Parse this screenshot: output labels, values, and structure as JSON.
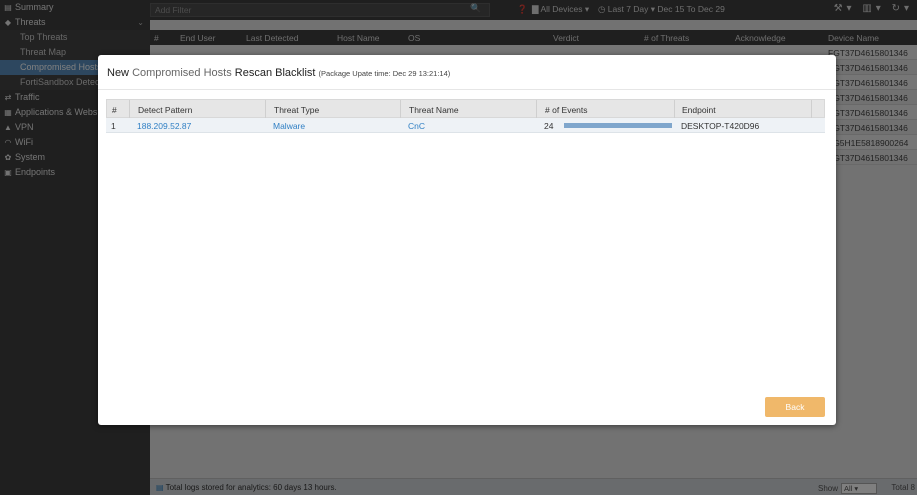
{
  "sidebar": {
    "items": [
      {
        "label": "Summary",
        "icon": "▤",
        "name": "sidebar-item-summary",
        "icon_name": "summary-icon",
        "sub": false
      },
      {
        "label": "Threats",
        "icon": "◆",
        "name": "sidebar-item-threats",
        "icon_name": "threats-icon",
        "sub": false,
        "expanded": true
      },
      {
        "label": "Top Threats",
        "name": "sidebar-item-top-threats",
        "sub": true
      },
      {
        "label": "Threat Map",
        "name": "sidebar-item-threat-map",
        "sub": true
      },
      {
        "label": "Compromised Hosts",
        "name": "sidebar-item-compromised-hosts",
        "sub": true,
        "active": true
      },
      {
        "label": "FortiSandbox Detecti",
        "name": "sidebar-item-fortisandbox",
        "sub": true
      },
      {
        "label": "Traffic",
        "icon": "⇄",
        "name": "sidebar-item-traffic",
        "icon_name": "traffic-icon",
        "sub": false
      },
      {
        "label": "Applications & Webs",
        "icon": "▦",
        "name": "sidebar-item-applications",
        "icon_name": "applications-icon",
        "sub": false
      },
      {
        "label": "VPN",
        "icon": "▲",
        "name": "sidebar-item-vpn",
        "icon_name": "lock-icon",
        "sub": false
      },
      {
        "label": "WiFi",
        "icon": "◠",
        "name": "sidebar-item-wifi",
        "icon_name": "wifi-icon",
        "sub": false
      },
      {
        "label": "System",
        "icon": "✿",
        "name": "sidebar-item-system",
        "icon_name": "gear-icon",
        "sub": false
      },
      {
        "label": "Endpoints",
        "icon": "▣",
        "name": "sidebar-item-endpoints",
        "icon_name": "endpoints-icon",
        "sub": false
      }
    ]
  },
  "toolbar": {
    "filter_placeholder": "Add Filter",
    "help": "❓",
    "devices": "All Devices ▾",
    "timerange": "Last 7 Day ▾  Dec 15 To Dec 29",
    "tools": "⚒▾ ▥▾ ↻▾"
  },
  "grid": {
    "columns": [
      "#",
      "End User",
      "Last Detected",
      "Host Name",
      "OS",
      "Verdict",
      "# of Threats",
      "Acknowledge",
      "Device Name"
    ],
    "device_names": [
      "FGT37D4615801346",
      "FGT37D4615801346",
      "FGT37D4615801346",
      "FGT37D4615801346",
      "FGT37D4615801346",
      "FGT37D4615801346",
      "FG5H1E5818900264",
      "FGT37D4615801346"
    ]
  },
  "modal": {
    "title_part1": "New ",
    "title_part2": "Compromised Hosts ",
    "title_part3": "Rescan Blacklist ",
    "title_part4": "(Package Upate time: Dec 29 13:21:14)",
    "columns": [
      "#",
      "Detect Pattern",
      "Threat Type",
      "Threat Name",
      "# of Events",
      "Endpoint"
    ],
    "rows": [
      {
        "num": "1",
        "pattern": "188.209.52.87",
        "type": "Malware",
        "name": "CnC",
        "events": "24",
        "events_fraction": 1.0,
        "endpoint": "DESKTOP-T420D96"
      }
    ],
    "back_label": "Back"
  },
  "footer": {
    "logs_text": "Total logs stored for analytics: 60 days 13 hours.",
    "show_label": "Show",
    "show_value": "All",
    "total_label": "Total 8"
  },
  "colors": {
    "sidebar_bg": "#3e3e3e",
    "active_item": "#5a8fbf",
    "link": "#2f7fc4",
    "event_bar": "#7fa6cc",
    "back_button": "#f0b86a"
  }
}
